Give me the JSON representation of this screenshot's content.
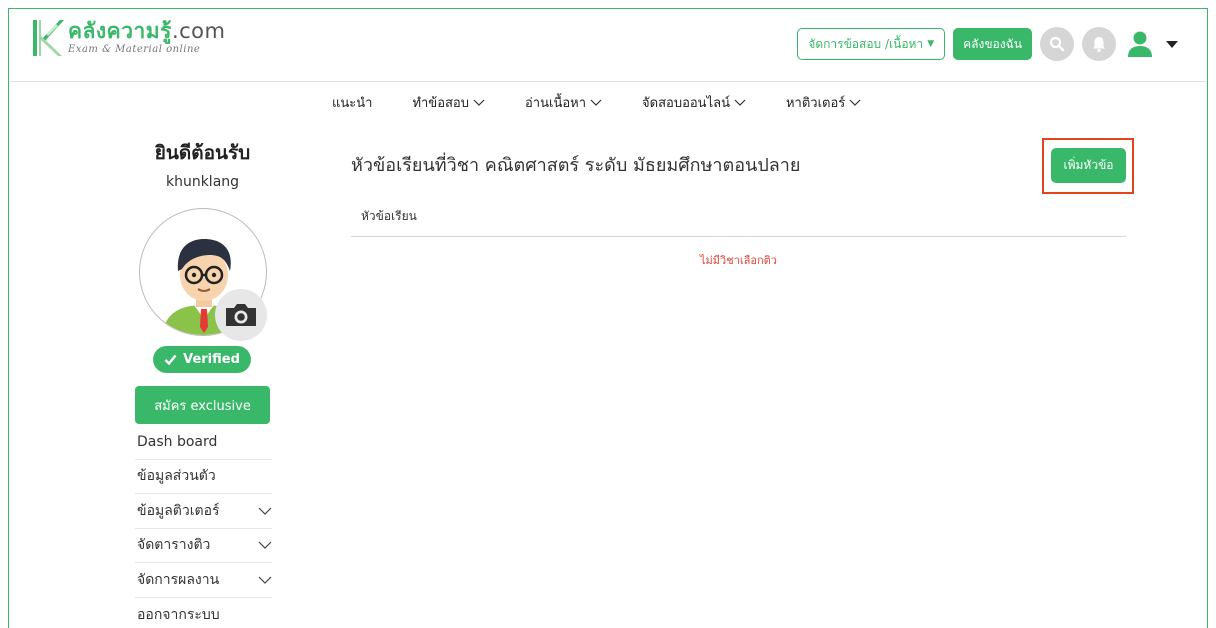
{
  "header": {
    "logo_title": "คลังความรู้",
    "logo_domain": ".com",
    "logo_subtitle": "Exam & Material online",
    "manage_btn": "จัดการข้อสอบ /เนื้อหา",
    "mystore_btn": "คลังของฉัน"
  },
  "nav": {
    "items": [
      {
        "label": "แนะนำ"
      },
      {
        "label": "ทำข้อสอบ"
      },
      {
        "label": "อ่านเนื้อหา"
      },
      {
        "label": "จัดสอบออนไลน์"
      },
      {
        "label": "หาติวเตอร์"
      }
    ]
  },
  "sidebar": {
    "welcome": "ยินดีต้อนรับ",
    "username": "khunklang",
    "verified": "Verified",
    "exclusive_btn": "สมัคร exclusive",
    "menu": [
      {
        "label": "Dash board"
      },
      {
        "label": "ข้อมูลส่วนตัว"
      },
      {
        "label": "ข้อมูลติวเตอร์"
      },
      {
        "label": "จัดตารางติว"
      },
      {
        "label": "จัดการผลงาน"
      },
      {
        "label": "ออกจากระบบ"
      }
    ]
  },
  "main": {
    "title": "หัวข้อเรียนที่วิชา คณิตศาสตร์ ระดับ มัธยมศึกษาตอนปลาย",
    "add_btn": "เพิ่มหัวข้อ",
    "column_header": "หัวข้อเรียน",
    "empty_message": "ไม่มีวิชาเลือกติว"
  },
  "colors": {
    "accent": "#39b86a",
    "highlight": "#e2451c",
    "error_text": "#e0453a"
  }
}
